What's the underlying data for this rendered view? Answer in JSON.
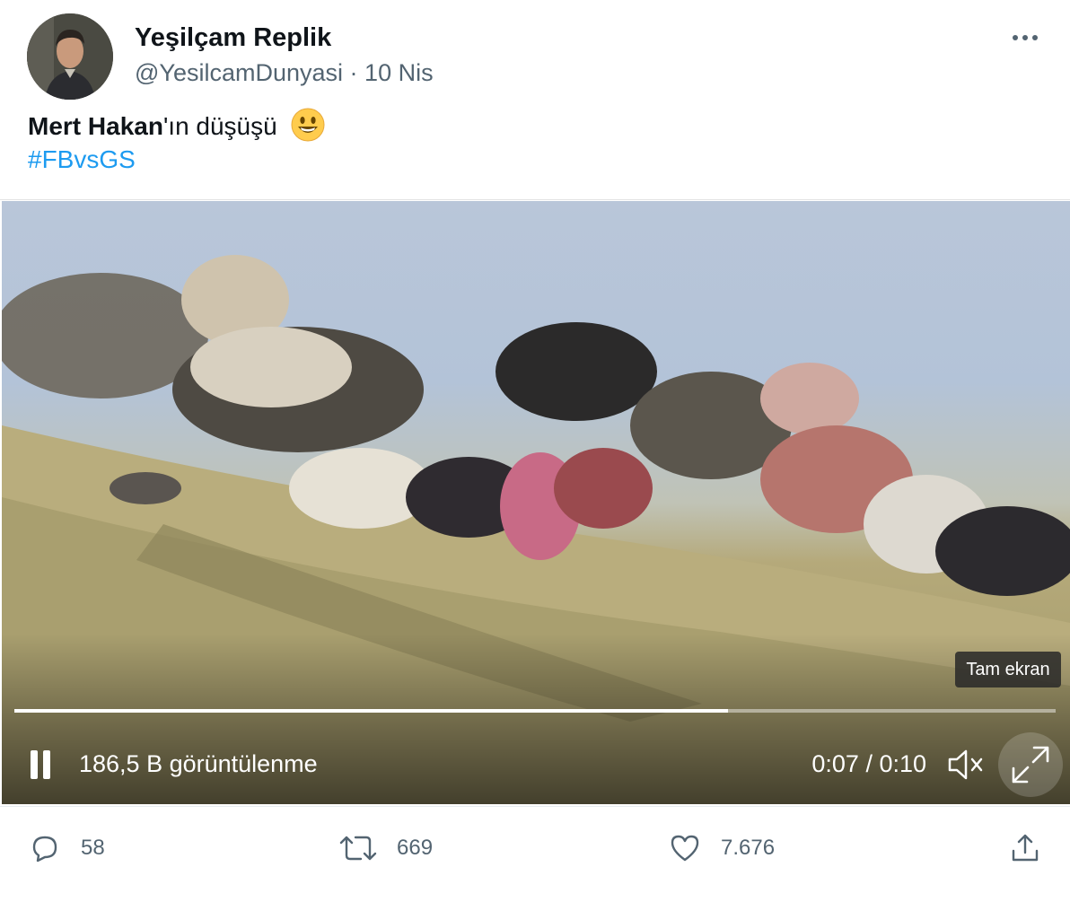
{
  "tweet": {
    "display_name": "Yeşilçam Replik",
    "handle": "@YesilcamDunyasi",
    "separator": "·",
    "date": "10 Nis",
    "text_bold": "Mert Hakan",
    "text_rest": "'ın düşüşü",
    "emoji": "smiling-face-emoji",
    "hashtag": "#FBvsGS"
  },
  "video": {
    "tooltip": "Tam ekran",
    "views": "186,5 B görüntülenme",
    "time": "0:07 / 0:10",
    "progress": 0.685,
    "icons": [
      "pause-icon",
      "mute-icon",
      "fullscreen-icon"
    ]
  },
  "actions": {
    "replies": "58",
    "retweets": "669",
    "likes": "7.676"
  },
  "colors": {
    "link": "#1d9bf0",
    "muted": "#536471",
    "text": "#0f1419"
  }
}
